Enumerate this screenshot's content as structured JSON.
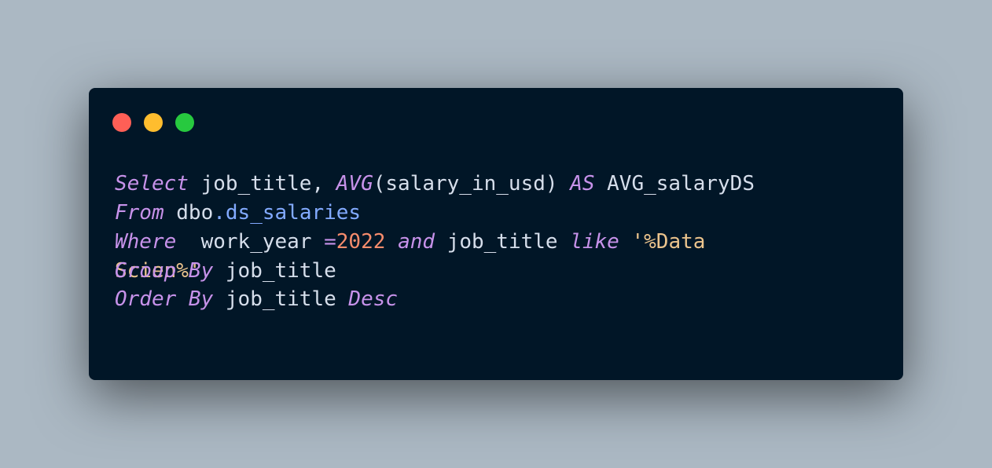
{
  "window": {
    "controls": [
      "close",
      "minimize",
      "maximize"
    ]
  },
  "colors": {
    "background": "#abb8c3",
    "editor": "#011627",
    "keyword": "#c792ea",
    "identifier": "#d6deeb",
    "property": "#82aaff",
    "number": "#f78c6c",
    "string": "#ecc48d"
  },
  "code": {
    "line1": {
      "kw1": "Select",
      "t1": " job_title, ",
      "kw2": "AVG",
      "t2": "(salary_in_usd) ",
      "kw3": "AS",
      "t3": " AVG_salaryDS"
    },
    "line2": {
      "kw1": "From",
      "t1": " dbo",
      "prop": ".ds_salaries"
    },
    "line3": {
      "kw1": "Where",
      "t1": "  work_year ",
      "op": "=",
      "num": "2022",
      "t2": " ",
      "kw2": "and",
      "t3": " job_title ",
      "kw3": "like",
      "t4": " ",
      "str": "'%Data"
    },
    "line3_wrap": {
      "str": "Scien%'"
    },
    "line4": {
      "kw1": "Group By",
      "t1": " job_title"
    },
    "line5": {
      "kw1": "Order By",
      "t1": " job_title ",
      "kw2": "Desc"
    }
  }
}
